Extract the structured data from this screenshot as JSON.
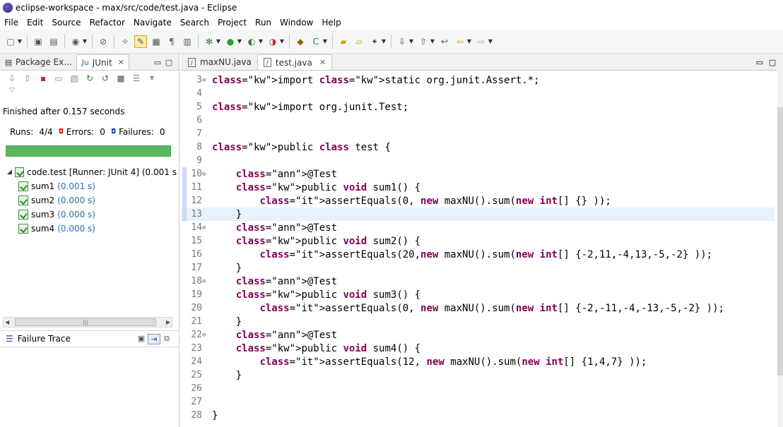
{
  "window": {
    "title": "eclipse-workspace - max/src/code/test.java - Eclipse"
  },
  "menu": [
    "File",
    "Edit",
    "Source",
    "Refactor",
    "Navigate",
    "Search",
    "Project",
    "Run",
    "Window",
    "Help"
  ],
  "left_panel": {
    "tabs": [
      {
        "label": "Package Ex...",
        "active": false
      },
      {
        "label": "JUnit",
        "active": true
      }
    ],
    "status": "Finished after 0.157 seconds",
    "runs_label": "Runs:",
    "runs_value": "4/4",
    "errors_label": "Errors:",
    "errors_value": "0",
    "failures_label": "Failures:",
    "failures_value": "0",
    "progress_color": "#5cb85c",
    "tree": {
      "root": "code.test [Runner: JUnit 4] (0.001 s",
      "children": [
        {
          "name": "sum1",
          "time": "(0.001 s)"
        },
        {
          "name": "sum2",
          "time": "(0.000 s)"
        },
        {
          "name": "sum3",
          "time": "(0.000 s)"
        },
        {
          "name": "sum4",
          "time": "(0.000 s)"
        }
      ]
    },
    "failure_trace": "Failure Trace"
  },
  "editor": {
    "tabs": [
      {
        "label": "maxNU.java",
        "active": false
      },
      {
        "label": "test.java",
        "active": true
      }
    ],
    "lines": [
      {
        "n": "3",
        "code": "import static org.junit.Assert.*;"
      },
      {
        "n": "4",
        "code": ""
      },
      {
        "n": "5",
        "code": "import org.junit.Test;"
      },
      {
        "n": "6",
        "code": ""
      },
      {
        "n": "7",
        "code": ""
      },
      {
        "n": "8",
        "code": "public class test {"
      },
      {
        "n": "9",
        "code": ""
      },
      {
        "n": "10",
        "code": "    @Test"
      },
      {
        "n": "11",
        "code": "    public void sum1() {"
      },
      {
        "n": "12",
        "code": "        assertEquals(0, new maxNU().sum(new int[] {} ));"
      },
      {
        "n": "13",
        "code": "    }"
      },
      {
        "n": "14",
        "code": "    @Test"
      },
      {
        "n": "15",
        "code": "    public void sum2() {"
      },
      {
        "n": "16",
        "code": "        assertEquals(20,new maxNU().sum(new int[] {-2,11,-4,13,-5,-2} ));"
      },
      {
        "n": "17",
        "code": "    }"
      },
      {
        "n": "18",
        "code": "    @Test"
      },
      {
        "n": "19",
        "code": "    public void sum3() {"
      },
      {
        "n": "20",
        "code": "        assertEquals(0, new maxNU().sum(new int[] {-2,-11,-4,-13,-5,-2} ));"
      },
      {
        "n": "21",
        "code": "    }"
      },
      {
        "n": "22",
        "code": "    @Test"
      },
      {
        "n": "23",
        "code": "    public void sum4() {"
      },
      {
        "n": "24",
        "code": "        assertEquals(12, new maxNU().sum(new int[] {1,4,7} ));"
      },
      {
        "n": "25",
        "code": "    }"
      },
      {
        "n": "26",
        "code": ""
      },
      {
        "n": "27",
        "code": ""
      },
      {
        "n": "28",
        "code": "}"
      }
    ],
    "current_line": "13"
  }
}
